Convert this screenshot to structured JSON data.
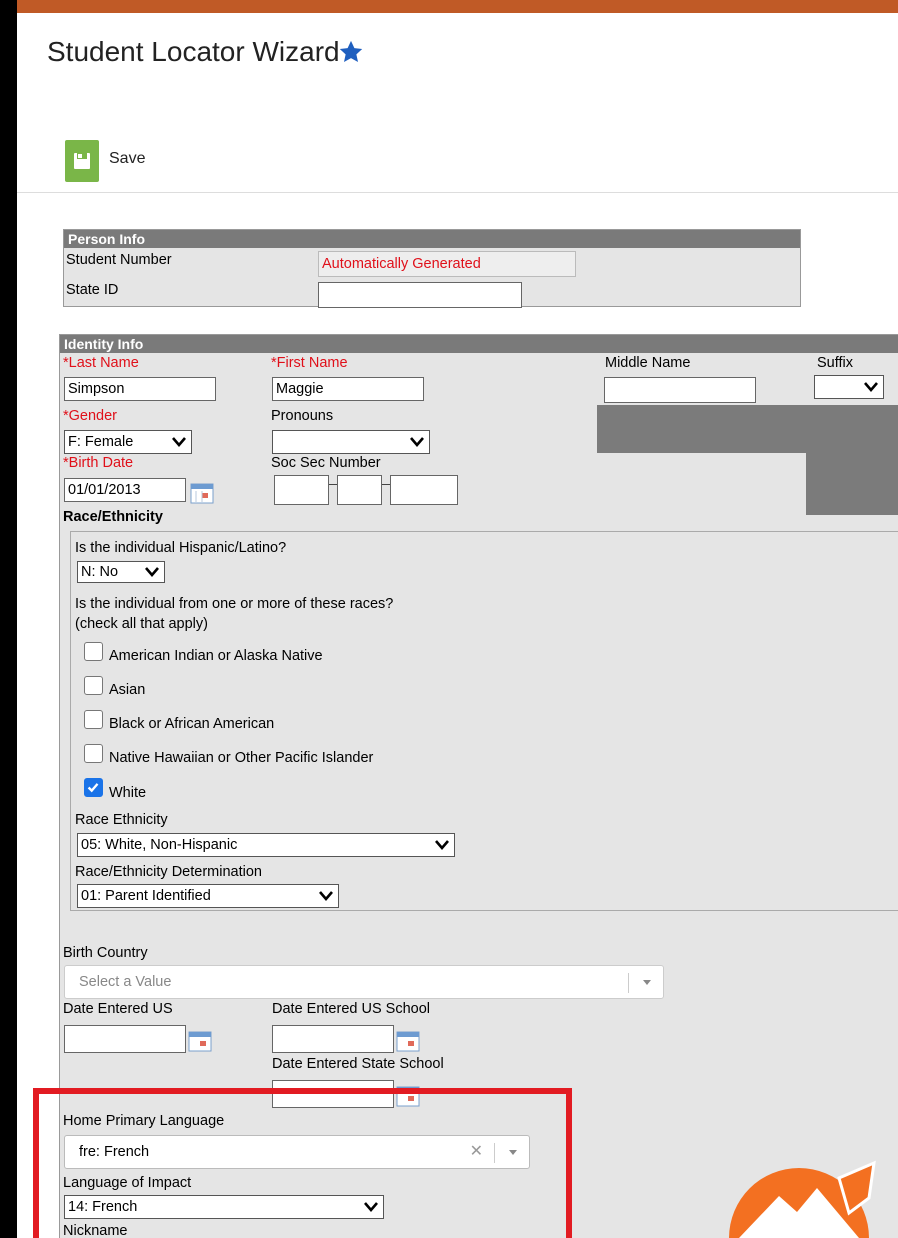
{
  "header": {
    "title": "Student Locator Wizard",
    "star_icon": "star-icon"
  },
  "toolbar": {
    "save_label": "Save",
    "save_icon": "floppy-disk-icon"
  },
  "person_info": {
    "heading": "Person Info",
    "student_number_label": "Student Number",
    "student_number_value": "Automatically Generated",
    "state_id_label": "State ID",
    "state_id_value": ""
  },
  "identity_info": {
    "heading": "Identity Info",
    "last_name_label": "*Last Name",
    "last_name_value": "Simpson",
    "first_name_label": "*First Name",
    "first_name_value": "Maggie",
    "middle_name_label": "Middle Name",
    "middle_name_value": "",
    "suffix_label": "Suffix",
    "suffix_value": "",
    "gender_label": "*Gender",
    "gender_value": "F: Female",
    "pronouns_label": "Pronouns",
    "pronouns_value": "",
    "birth_date_label": "*Birth Date",
    "birth_date_value": "01/01/2013",
    "ssn_label": "Soc Sec Number"
  },
  "race": {
    "heading": "Race/Ethnicity",
    "hispanic_question": "Is the individual Hispanic/Latino?",
    "hispanic_value": "N: No",
    "races_question": "Is the individual from one or more of these races?",
    "races_hint": "(check all that apply)",
    "options": [
      {
        "label": "American Indian or Alaska Native",
        "checked": false
      },
      {
        "label": "Asian",
        "checked": false
      },
      {
        "label": "Black or African American",
        "checked": false
      },
      {
        "label": "Native Hawaiian or Other Pacific Islander",
        "checked": false
      },
      {
        "label": "White",
        "checked": true
      }
    ],
    "race_ethnicity_label": "Race Ethnicity",
    "race_ethnicity_value": "05: White, Non-Hispanic",
    "determination_label": "Race/Ethnicity Determination",
    "determination_value": "01: Parent Identified"
  },
  "other": {
    "birth_country_label": "Birth Country",
    "birth_country_placeholder": "Select a Value",
    "date_entered_us_label": "Date Entered US",
    "date_entered_us_school_label": "Date Entered US School",
    "date_entered_state_school_label": "Date Entered State School",
    "home_language_label": "Home Primary Language",
    "home_language_value": "fre: French",
    "language_impact_label": "Language of Impact",
    "language_impact_value": "14: French",
    "nickname_label": "Nickname"
  },
  "colors": {
    "top_bar": "#c05a26",
    "required": "#e0101a",
    "highlight": "#e21b22",
    "save_green": "#7ab648"
  }
}
